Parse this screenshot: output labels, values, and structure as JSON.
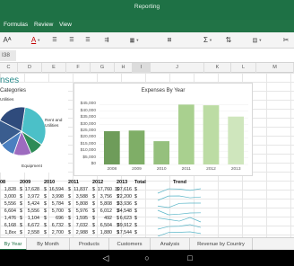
{
  "window": {
    "title": "Reporting"
  },
  "menu": [
    "Formulas",
    "Review",
    "View"
  ],
  "formula_bar": {
    "name_box": "I38"
  },
  "columns": [
    "C",
    "D",
    "E",
    "F",
    "G",
    "H",
    "I",
    "J",
    "K",
    "L",
    "M"
  ],
  "active_column": "I",
  "sheet_title": "nses",
  "pie_chart": {
    "title": "Categories",
    "labels": [
      "Utilities",
      "Rent and\nUtilities",
      "Equipment"
    ],
    "slices": [
      {
        "value": 32,
        "color": "#4bc0c8"
      },
      {
        "value": 9,
        "color": "#2e8b57"
      },
      {
        "value": 12,
        "color": "#9d6bbf"
      },
      {
        "value": 10,
        "color": "#4a7fc0"
      },
      {
        "value": 17,
        "color": "#3a5d8f"
      },
      {
        "value": 20,
        "color": "#2f4b7c"
      }
    ]
  },
  "chart_data": {
    "type": "bar",
    "title": "Expenses By Year",
    "categories": [
      "2008",
      "2009",
      "2010",
      "2011",
      "2012",
      "2013"
    ],
    "values": [
      25000,
      25500,
      17500,
      45000,
      44500,
      36000
    ],
    "ylim": [
      0,
      50000
    ],
    "yticks": [
      "$0",
      "$5,000",
      "$10,000",
      "$15,000",
      "$20,000",
      "$25,000",
      "$30,000",
      "$35,000",
      "$40,000",
      "$45,000"
    ],
    "colors": [
      "#6e9c5a",
      "#7fae67",
      "#95c07d",
      "#a9d08f",
      "#bcdca4",
      "#cfe6bd"
    ]
  },
  "table": {
    "headers": [
      "08",
      "2009",
      "2010",
      "2011",
      "2012",
      "2013",
      "Total",
      "Trend"
    ],
    "rows": [
      [
        "1,828",
        "17,628",
        "16,594",
        "11,837",
        "17,760",
        "107,616"
      ],
      [
        "3,000",
        "3,972",
        "3,998",
        "3,588",
        "3,756",
        "22,200"
      ],
      [
        "5,556",
        "5,424",
        "5,784",
        "5,808",
        "5,808",
        "33,936"
      ],
      [
        "6,604",
        "5,556",
        "5,700",
        "5,976",
        "6,012",
        "34,548"
      ],
      [
        "1,476",
        "1,104",
        "696",
        "1,595",
        "492",
        "6,623"
      ],
      [
        "6,168",
        "6,672",
        "6,732",
        "7,032",
        "6,504",
        "39,912"
      ],
      [
        "1,8xx",
        "2,558",
        "2,700",
        "2,988",
        "1,880",
        "17,544"
      ]
    ]
  },
  "tabs": [
    "By Year",
    "By Month",
    "Products",
    "Customers",
    "Analysis",
    "Revenue by Country"
  ],
  "active_tab": "By Year",
  "toolbar_icons": [
    "paste-icon",
    "font-color-icon",
    "fill-icon",
    "bold-icon",
    "align-icon",
    "wrap-icon",
    "sort-icon",
    "autosum-icon",
    "filter-icon",
    "merge-icon",
    "insert-icon"
  ]
}
